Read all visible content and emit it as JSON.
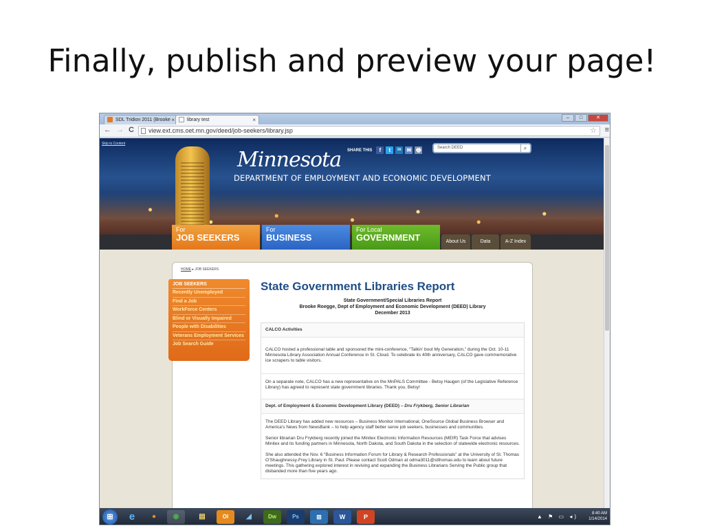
{
  "slide": {
    "title": "Finally, publish and preview your page!"
  },
  "browser": {
    "tabs": [
      {
        "label": "SDL Tridion 2011 (Brooke",
        "close": "×"
      },
      {
        "label": "library test",
        "close": "×"
      }
    ],
    "nav": {
      "back": "←",
      "forward": "→",
      "reload": "C"
    },
    "url": "view.ext.cms.oet.mn.gov/deed/job-seekers/library.jsp",
    "bookmark_icon": "☆",
    "menu_icon": "≡"
  },
  "site": {
    "skip_link": "Skip to Content",
    "share_label": "SHARE THIS",
    "share_icons": [
      "f",
      "t",
      "in",
      "✉",
      "🖶"
    ],
    "search_placeholder": "Search DEED",
    "search_icon": "⌕",
    "logo_script": "Minnesota",
    "department": "DEPARTMENT OF EMPLOYMENT AND ECONOMIC DEVELOPMENT",
    "main_tabs": [
      {
        "small": "For",
        "big": "JOB SEEKERS"
      },
      {
        "small": "For",
        "big": "BUSINESS"
      },
      {
        "small": "For Local",
        "big": "GOVERNMENT"
      }
    ],
    "small_tabs": [
      "About Us",
      "Data",
      "A-Z Index"
    ],
    "breadcrumb": {
      "home": "HOME",
      "sep": "▸",
      "current": "JOB SEEKERS"
    },
    "leftnav": {
      "header": "JOB SEEKERS",
      "items": [
        "Recently Unemployed",
        "Find a Job",
        "WorkForce Centers",
        "Blind or Visually Impaired",
        "People with Disabilities",
        "Veterans Employment Services",
        "Job Search Guide"
      ]
    },
    "page_title": "State Government Libraries Report",
    "report_header": {
      "line1": "State Government/Special Libraries Report",
      "line2": "Brooke Roegge, Dept of Employment and Economic Development (DEED) Library",
      "line3": "December 2013"
    },
    "report": {
      "calco_heading": "CALCO Activities",
      "calco_p1": "CALCO hosted a professional table and sponsored the mini-conference, “Talkin’ bout My Generation,” during the Oct. 10-11 Minnesota Library Association Annual Conference in St. Cloud. To celebrate its 40th anniversary, CALCO gave commemorative ice scrapers to table visitors.",
      "calco_p2": "On a separate note, CALCO has a new representative on the MnPALS Committee - Betsy Haugen (of the Legislative Reference Library) has agreed to represent state government libraries. Thank you, Betsy!",
      "deed_heading": "Dept. of Employment & Economic Development Library (DEED) – ",
      "deed_heading_italic": "Dru Frykberg, Senior Librarian",
      "deed_p1": "The DEED Library has added new resources – Business Monitor International, OneSource Global Business Browser and America’s News from NewsBank – to help agency staff better serve job seekers, businesses and communities.",
      "deed_p2": "Senior librarian Dru Frykberg recently joined the Minitex Electronic Information Resources (MEIR) Task Force that advises Minitex and its funding partners in Minnesota, North Dakota, and South Dakota in the selection of statewide electronic resources.",
      "deed_p3_a": "She also attended the Nov. 6 “Business Information Forum for Library & Research Professionals” at the University of St. Thomas O’Shaughnessy-Frey Library in St. Paul. Please contact Scott Odman at ",
      "deed_p3_link": "odma3011@stthomas.edu",
      "deed_p3_b": " to learn about future meetings. This gathering explored interest in reviving and expanding the Business Librarians Serving the Public group that disbanded more than five years ago."
    }
  },
  "taskbar": {
    "apps": [
      "e",
      "●",
      "◉",
      "▤",
      "Ol",
      "◢",
      "Dw",
      "Ps",
      "⊞",
      "W",
      "P"
    ],
    "tray_icons": "▲ ⚑ ▭ ◂)",
    "time": "8:40 AM",
    "date": "1/14/2014"
  }
}
